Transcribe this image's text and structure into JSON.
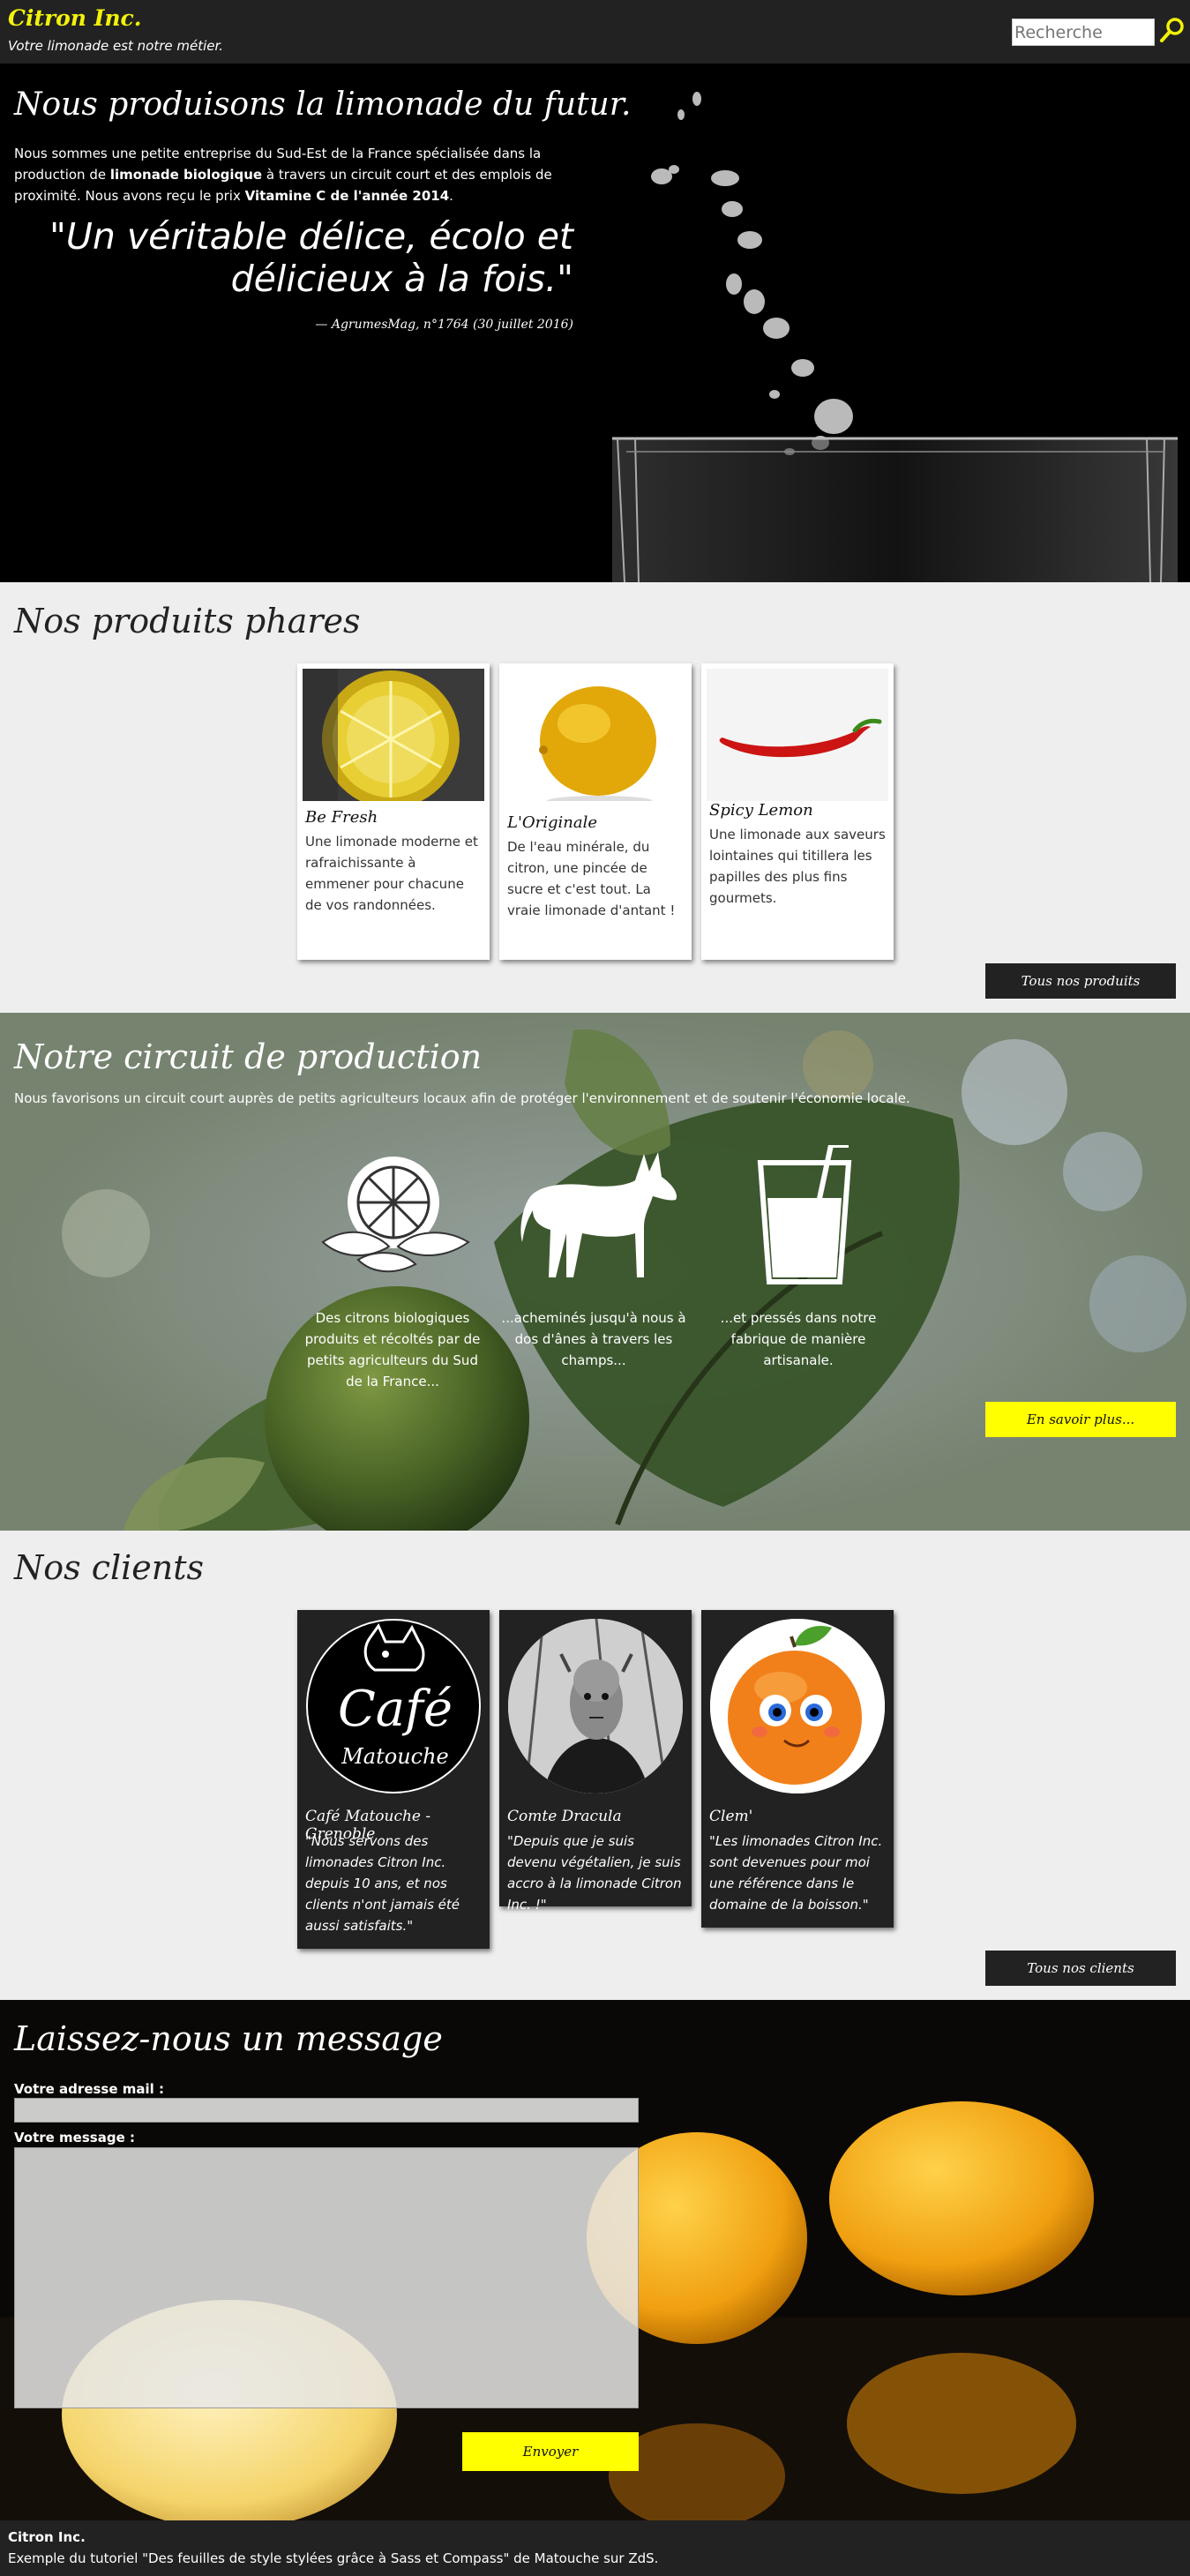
{
  "header": {
    "brand": "Citron Inc.",
    "tagline": "Votre limonade est notre métier.",
    "search_placeholder": "Recherche"
  },
  "hero": {
    "title": "Nous produisons la limonade du futur.",
    "text_1": "Nous sommes une petite entreprise du Sud-Est de la France spécialisée dans la production de ",
    "text_bold_1": "limonade biologique",
    "text_2": " à travers un circuit court et des emplois de proximité. Nous avons reçu le prix ",
    "text_bold_2": "Vitamine C de l'année 2014",
    "text_3": ".",
    "quote": "\"Un véritable délice, écolo et délicieux à la fois.\"",
    "quote_source": "— AgrumesMag, n°1764 (30 juillet 2016)"
  },
  "products": {
    "title": "Nos produits phares",
    "items": [
      {
        "name": "Be Fresh",
        "description": "Une limonade moderne et rafraichissante à emmener pour chacune de vos randonnées."
      },
      {
        "name": "L'Originale",
        "description": "De l'eau minérale, du citron, une pincée de sucre et c'est tout. La vraie limonade d'antant !"
      },
      {
        "name": "Spicy Lemon",
        "description": "Une limonade aux saveurs lointaines qui titillera les papilles des plus fins gourmets."
      }
    ],
    "all_button": "Tous nos produits"
  },
  "production": {
    "title": "Notre circuit de production",
    "subtitle": "Nous favorisons un circuit court auprès de petits agriculteurs locaux afin de protéger l'environnement et de soutenir l'économie locale.",
    "steps": [
      {
        "icon": "lemon-icon",
        "caption": "Des citrons biologiques produits et récoltés par de petits agriculteurs du Sud de la France..."
      },
      {
        "icon": "donkey-icon",
        "caption": "...acheminés jusqu'à nous à dos d'ânes à travers les champs..."
      },
      {
        "icon": "glass-icon",
        "caption": "...et pressés dans notre fabrique de manière artisanale."
      }
    ],
    "more_button": "En savoir plus..."
  },
  "clients": {
    "title": "Nos clients",
    "items": [
      {
        "name": "Café Matouche - Grenoble",
        "quote": "\"Nous servons des limonades Citron Inc. depuis 10 ans, et nos clients n'ont jamais été aussi satisfaits.\"",
        "logo_main": "Café",
        "logo_sub": "Matouche"
      },
      {
        "name": "Comte Dracula",
        "quote": "\"Depuis que je suis devenu végétalien, je suis accro à la limonade Citron Inc. !\""
      },
      {
        "name": "Clem'",
        "quote": "\"Les limonades Citron Inc. sont devenues pour moi une référence dans le domaine de la boisson.\""
      }
    ],
    "all_button": "Tous nos clients"
  },
  "contact": {
    "title": "Laissez-nous un message",
    "email_label": "Votre adresse mail :",
    "message_label": "Votre message :",
    "send_button": "Envoyer"
  },
  "footer": {
    "title": "Citron Inc.",
    "text": "Exemple du tutoriel \"Des feuilles de style stylées grâce à Sass et Compass\" de Matouche sur ZdS."
  },
  "colors": {
    "accent_yellow": "#ffff00",
    "brand_yellow": "#f2f20a",
    "dark": "#222222",
    "light_bg": "#eeeeee"
  }
}
